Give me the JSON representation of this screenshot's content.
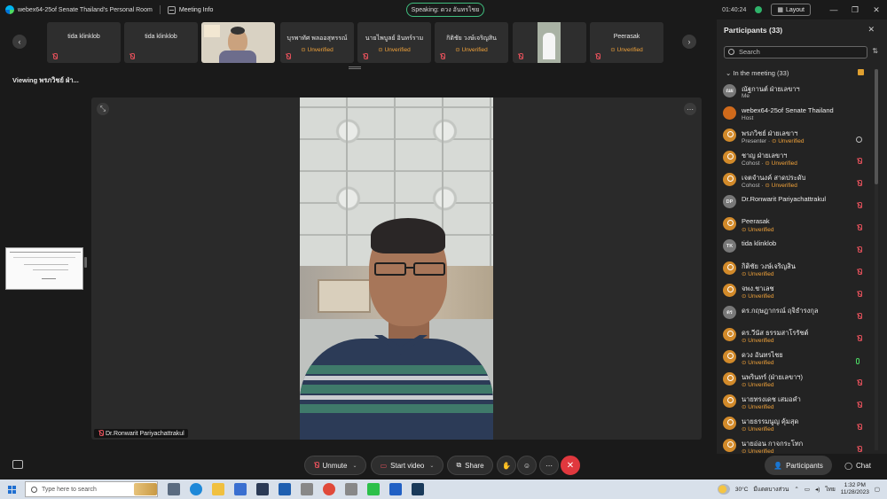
{
  "titlebar": {
    "meeting_title": "webex64-25of Senate Thailand's Personal Room",
    "meeting_info": "Meeting Info",
    "speaking": "Speaking: ดวง อันทรไชย",
    "elapsed": "01:40:24",
    "layout_label": "Layout"
  },
  "thumbnails": [
    {
      "name": "tida klinklob",
      "status": ""
    },
    {
      "name": "tida klinklob",
      "status": ""
    },
    {
      "name": "",
      "status": ""
    },
    {
      "name": "บุรพาทัศ พลออสุทรรณ์",
      "status": "Unverified"
    },
    {
      "name": "นายไพบูลย์ อินทร์ราม",
      "status": "Unverified"
    },
    {
      "name": "กิติชัย วงษ์เจริญสิน",
      "status": "Unverified"
    },
    {
      "name": "",
      "status": ""
    },
    {
      "name": "Peerasak",
      "status": "Unverified"
    }
  ],
  "viewing_label": "Viewing พรภวิชย์ ฝ่า...",
  "stage": {
    "active_speaker": "Dr.Ronwarit Pariyachattrakul"
  },
  "toolbar": {
    "unmute": "Unmute",
    "start_video": "Start video",
    "share": "Share",
    "participants": "Participants",
    "chat": "Chat"
  },
  "panel": {
    "title": "Participants (33)",
    "search_placeholder": "Search",
    "group": "In the meeting (33)",
    "participants": [
      {
        "initials": "ณผ",
        "name": "ณัฐกานต์ ฝ่ายเลขาฯ",
        "sub": "Me",
        "unverified": "",
        "avatar": "gray",
        "icon": "none"
      },
      {
        "initials": "",
        "name": "webex64-25of Senate Thailand",
        "sub": "Host",
        "unverified": "",
        "avatar": "org",
        "icon": "none"
      },
      {
        "initials": "",
        "name": "พรภวิชย์ ฝ่ายเลขาฯ",
        "sub": "Presenter · ",
        "unverified": "Unverified",
        "avatar": "person",
        "icon": "share"
      },
      {
        "initials": "",
        "name": "ชาญ ฝ่ายเลขาฯ",
        "sub": "Cohost · ",
        "unverified": "Unverified",
        "avatar": "person",
        "icon": "muted"
      },
      {
        "initials": "",
        "name": "เจตจำนงค์ สาดประดับ",
        "sub": "Cohost · ",
        "unverified": "Unverified",
        "avatar": "person",
        "icon": "muted"
      },
      {
        "initials": "DP",
        "name": "Dr.Ronwarit Pariyachattrakul",
        "sub": "",
        "unverified": "",
        "avatar": "gray",
        "icon": "muted"
      },
      {
        "initials": "",
        "name": "Peerasak",
        "sub": "",
        "unverified": "Unverified",
        "avatar": "person",
        "icon": "muted"
      },
      {
        "initials": "TK",
        "name": "tida klinklob",
        "sub": "",
        "unverified": "",
        "avatar": "gray",
        "icon": "muted"
      },
      {
        "initials": "",
        "name": "กิติชัย วงษ์เจริญสิน",
        "sub": "",
        "unverified": "Unverified",
        "avatar": "person",
        "icon": "muted"
      },
      {
        "initials": "",
        "name": "จพง.ชาเลช",
        "sub": "",
        "unverified": "Unverified",
        "avatar": "person",
        "icon": "muted"
      },
      {
        "initials": "ดร",
        "name": "ดร.กฤษฎากรณ์ ฤจิธำรงกุล",
        "sub": "",
        "unverified": "",
        "avatar": "gray",
        "icon": "muted"
      },
      {
        "initials": "",
        "name": "ดร.วีนัส ธรรมสาโรรัชต์",
        "sub": "",
        "unverified": "Unverified",
        "avatar": "person",
        "icon": "muted"
      },
      {
        "initials": "",
        "name": "ดวง อันทรไชย",
        "sub": "",
        "unverified": "Unverified",
        "avatar": "person",
        "icon": "mic"
      },
      {
        "initials": "",
        "name": "นพรินทร์ (ฝ่ายเลขาฯ)",
        "sub": "",
        "unverified": "Unverified",
        "avatar": "person",
        "icon": "muted"
      },
      {
        "initials": "",
        "name": "นายทรงเดช เสมอคำ",
        "sub": "",
        "unverified": "Unverified",
        "avatar": "person",
        "icon": "muted"
      },
      {
        "initials": "",
        "name": "นายธรรมนูญ คุ้มสุด",
        "sub": "",
        "unverified": "Unverified",
        "avatar": "person",
        "icon": "muted"
      },
      {
        "initials": "",
        "name": "นายอ่อน กาจกระโทก",
        "sub": "",
        "unverified": "Unverified",
        "avatar": "person",
        "icon": "muted"
      }
    ]
  },
  "taskbar": {
    "search_placeholder": "Type here to search",
    "temperature": "30°C",
    "weather_text": "มีแดดบางส่วน",
    "language": "ไทย",
    "time": "1:32 PM",
    "date": "11/28/2023"
  },
  "colors": {
    "accent_green": "#3fbf7f",
    "unverified_orange": "#f2a33a",
    "leave_red": "#e0383e",
    "muted_red": "#e0505a"
  }
}
